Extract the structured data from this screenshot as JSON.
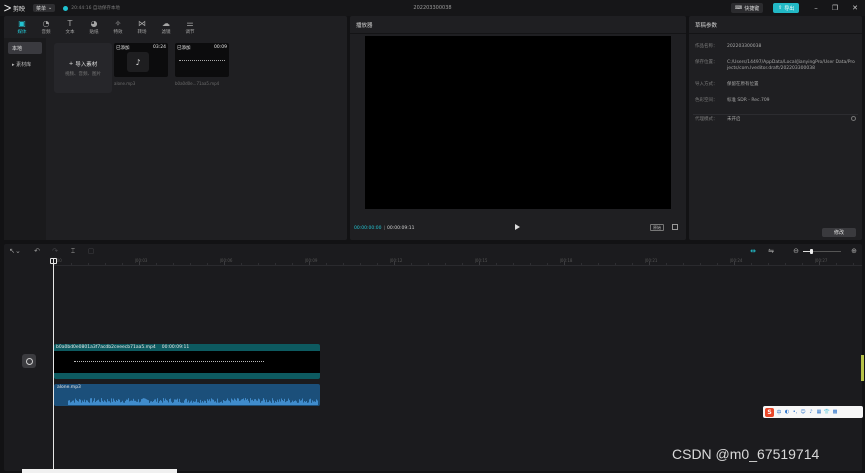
{
  "titlebar": {
    "app_name": "剪映",
    "menu_label": "菜单",
    "autosave": "20:44:16 自动保存本地",
    "doc_title": "202203300038",
    "shortcut_label": "快捷键",
    "export_label": "导出",
    "window_controls": [
      "minimize-icon",
      "maximize-icon",
      "close-icon"
    ]
  },
  "media": {
    "tabs": [
      {
        "label": "媒体",
        "icon": "media-icon",
        "active": true
      },
      {
        "label": "音频",
        "icon": "audio-icon",
        "active": false
      },
      {
        "label": "文本",
        "icon": "text-icon",
        "active": false
      },
      {
        "label": "贴纸",
        "icon": "sticker-icon",
        "active": false
      },
      {
        "label": "特效",
        "icon": "effects-icon",
        "active": false
      },
      {
        "label": "转场",
        "icon": "transition-icon",
        "active": false
      },
      {
        "label": "滤镜",
        "icon": "filter-icon",
        "active": false
      },
      {
        "label": "调节",
        "icon": "adjust-icon",
        "active": false
      }
    ],
    "sidebar": [
      {
        "label": "本地",
        "active": true
      },
      {
        "label": "▸ 素材库",
        "active": false
      }
    ],
    "import": {
      "title": "导入素材",
      "hint": "视频、音频、图片"
    },
    "items": [
      {
        "badge": "已添加",
        "duration": "03:24",
        "name": "alone.mp3"
      },
      {
        "badge": "已添加",
        "duration": "00:09",
        "name": "b0a0d0e...71aa5.mp4"
      }
    ]
  },
  "player": {
    "title": "播放器",
    "current_time": "00:00:00:00",
    "total_time": "00:00:09:11",
    "ratio_label": "原始"
  },
  "draft": {
    "title": "草稿参数",
    "params": [
      {
        "key": "作品名称：",
        "value": "202203300038"
      },
      {
        "key": "保存位置：",
        "value": "C:/Users/14497/AppData/Local/JianyingPro/User Data/Projects/com.lveditor.draft/202203300038"
      },
      {
        "key": "导入方式：",
        "value": "保留在原有位置"
      },
      {
        "key": "色彩空间：",
        "value": "标准 SDR - Rec.709"
      }
    ],
    "proxy_key": "代理模式：",
    "proxy_value": "未开启",
    "modify_label": "修改"
  },
  "timeline": {
    "ruler_labels": [
      "00:00",
      "|00:03",
      "|00:06",
      "|00:09",
      "|00:12",
      "|00:15",
      "|00:18",
      "|00:21",
      "|00:24",
      "|00:27"
    ],
    "video_clip": {
      "name": "b0a0bd0e0801a3f7acdb2ceeecb71aa5.mp4",
      "duration": "00:00:09:11"
    },
    "audio_clip": {
      "name": "alone.mp3"
    },
    "zoom_level": 0.2
  },
  "overlay": {
    "watermark": "CSDN @m0_67519714",
    "ime_logo": "S",
    "ime_lang": "中"
  }
}
